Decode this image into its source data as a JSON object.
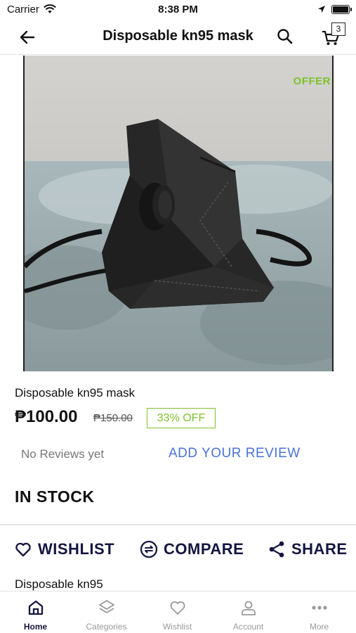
{
  "status_bar": {
    "carrier": "Carrier",
    "time": "8:38 PM"
  },
  "header": {
    "title": "Disposable kn95 mask",
    "cart_count": "3",
    "back_icon": "arrow-left-icon",
    "search_icon": "search-icon",
    "cart_icon": "cart-icon"
  },
  "product": {
    "offer_tag": "OFFER",
    "name": "Disposable kn95 mask",
    "price": "₱100.00",
    "old_price": "₱150.00",
    "discount": "33% OFF",
    "reviews_text": "No Reviews yet",
    "add_review": "ADD YOUR REVIEW",
    "stock": "IN STOCK",
    "description_title": "Disposable kn95"
  },
  "actions": {
    "wishlist": "WISHLIST",
    "compare": "COMPARE",
    "share": "SHARE"
  },
  "bottom_nav": {
    "items": [
      {
        "label": "Home",
        "icon": "home-icon",
        "active": true
      },
      {
        "label": "Categories",
        "icon": "layers-icon",
        "active": false
      },
      {
        "label": "Wishlist",
        "icon": "heart-icon",
        "active": false
      },
      {
        "label": "Account",
        "icon": "user-icon",
        "active": false
      },
      {
        "label": "More",
        "icon": "more-dots-icon",
        "active": false
      }
    ]
  },
  "colors": {
    "accent_green": "#7ec128",
    "link_blue": "#4a72d9",
    "navy": "#151540"
  }
}
